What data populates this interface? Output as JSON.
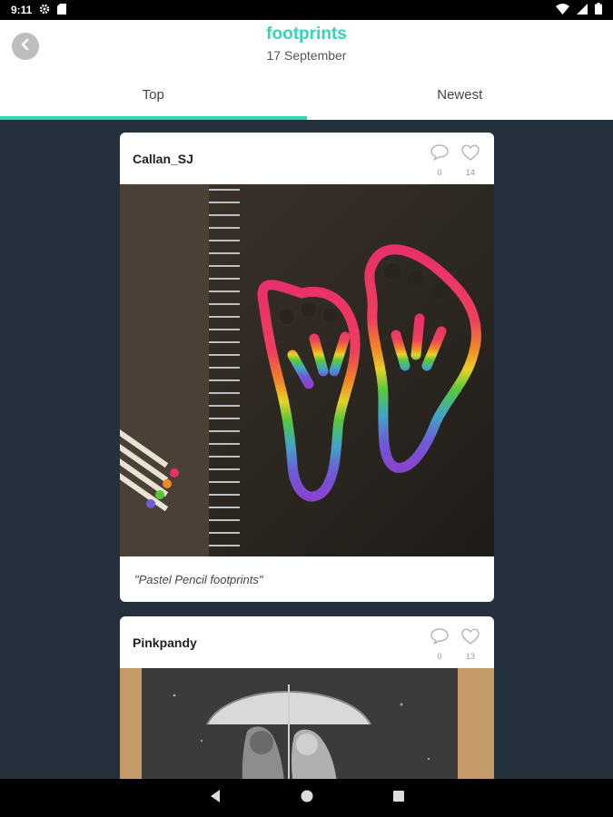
{
  "status_bar": {
    "time": "9:11",
    "icons": [
      "settings-icon",
      "sd-card-icon",
      "wifi-icon",
      "signal-icon",
      "battery-icon"
    ]
  },
  "header": {
    "title": "footprints",
    "subtitle": "17 September",
    "back_icon": "chevron-left-icon"
  },
  "tabs": [
    {
      "label": "Top",
      "active": true
    },
    {
      "label": "Newest",
      "active": false
    }
  ],
  "posts": [
    {
      "username": "Callan_SJ",
      "comments": "0",
      "likes": "14",
      "caption": "\"Pastel Pencil footprints\""
    },
    {
      "username": "Pinkpandy",
      "comments": "0",
      "likes": "13"
    }
  ],
  "nav_bar": {
    "icons": [
      "back-triangle-icon",
      "home-circle-icon",
      "recents-square-icon"
    ]
  },
  "colors": {
    "accent": "#35d6b3",
    "background": "#24303b"
  }
}
